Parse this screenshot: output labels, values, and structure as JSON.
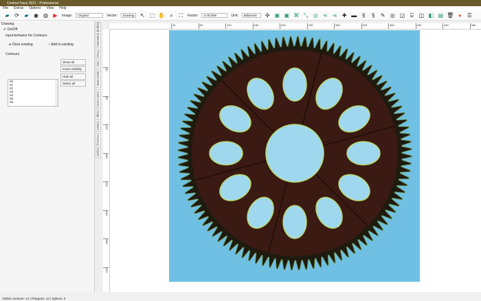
{
  "title": "ContourTrace 2021 - Professional",
  "menu": [
    "File",
    "Extras",
    "Options",
    "View",
    "Help"
  ],
  "toolbar": {
    "image_label": "Image:",
    "image_value": "Original",
    "vector_label": "Vector:",
    "vector_value": "Drawing",
    "factor_label": "Factor:",
    "factor_value": "0.007066",
    "unit_label": "Unit:",
    "unit_value": "Millimeter"
  },
  "panel": {
    "title": "Drawing",
    "checkbox_label": "On/Off",
    "checkbox_checked": true,
    "input_label": "Input behavior for Contours",
    "clear_existing": "Clear existing",
    "add_to_existing": "Add to existing",
    "contours_label": "Contours",
    "contours": [
      "00",
      "01",
      "02",
      "03",
      "04",
      "05",
      "06"
    ],
    "buttons": [
      "Show all",
      "Invert visibility",
      "Hide all",
      "Select all"
    ]
  },
  "tabs": [
    "Original",
    "Calibration",
    "Posts",
    "Blur",
    "Black-White",
    "Invert Colors",
    "Edge",
    "Detect",
    "Drawing",
    "Export"
  ],
  "active_tab": "Drawing",
  "ruler_top": [
    "40",
    "80",
    "120",
    "160",
    "200",
    "240",
    "280",
    "320",
    "360",
    "400",
    "440",
    "480",
    "520"
  ],
  "ruler_left": [
    "40",
    "80",
    "120",
    "160",
    "200",
    "240",
    "280",
    "320",
    "360"
  ],
  "status": "Visible contours: 14 | Polygons: 14 | Splines: 0",
  "colors": {
    "image_bg": "#6fc0e2",
    "gear": "#3a1a12",
    "titlebar": "#6b5a2a"
  }
}
